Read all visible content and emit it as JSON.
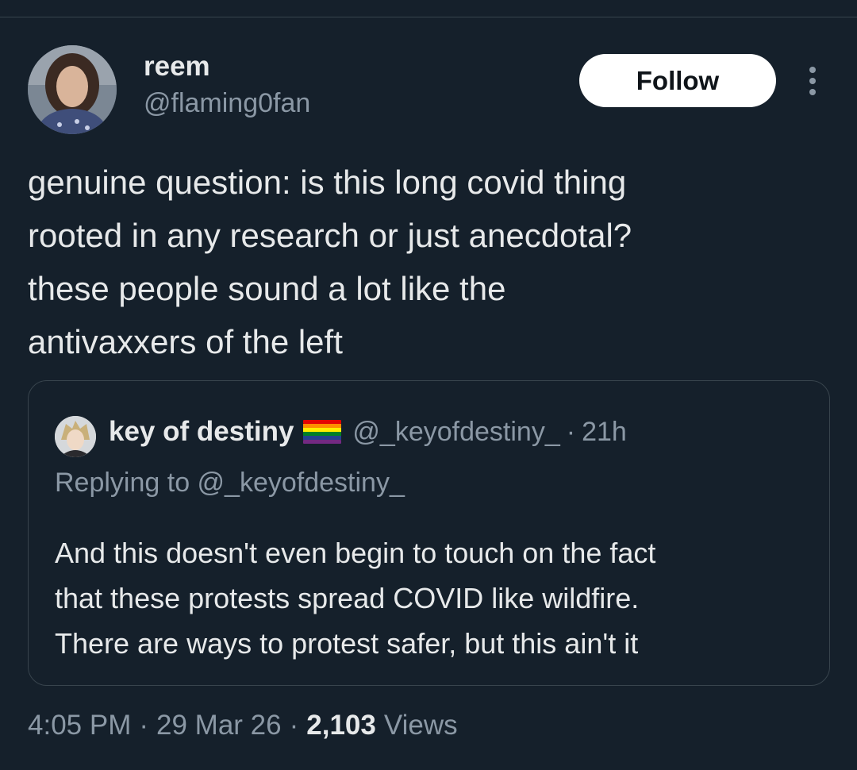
{
  "author": {
    "display_name": "reem",
    "handle": "@flaming0fan"
  },
  "follow_label": "Follow",
  "tweet_text": "genuine question: is this long covid thing\nrooted in any research or just anecdotal?\nthese people sound a lot like the\nantivaxxers of the left",
  "quoted": {
    "display_name": "key of destiny",
    "flag_icon": "rainbow-flag-icon",
    "handle": "@_keyofdestiny_",
    "separator": "·",
    "time": "21h",
    "replying_to": "Replying to @_keyofdestiny_",
    "text": "And this doesn't even begin to touch on the fact\nthat these protests spread COVID like wildfire.\nThere are ways to protest safer, but this ain't it"
  },
  "footer": {
    "time": "4:05 PM",
    "separator": "·",
    "date": "29 Mar 26",
    "views_count": "2,103",
    "views_label": "Views"
  },
  "colors": {
    "background": "#15202b",
    "primary_text": "#e7e9ea",
    "secondary_text": "#8b98a5",
    "border": "#38444d",
    "follow_button_bg": "#ffffff",
    "follow_button_text": "#0f1419"
  }
}
